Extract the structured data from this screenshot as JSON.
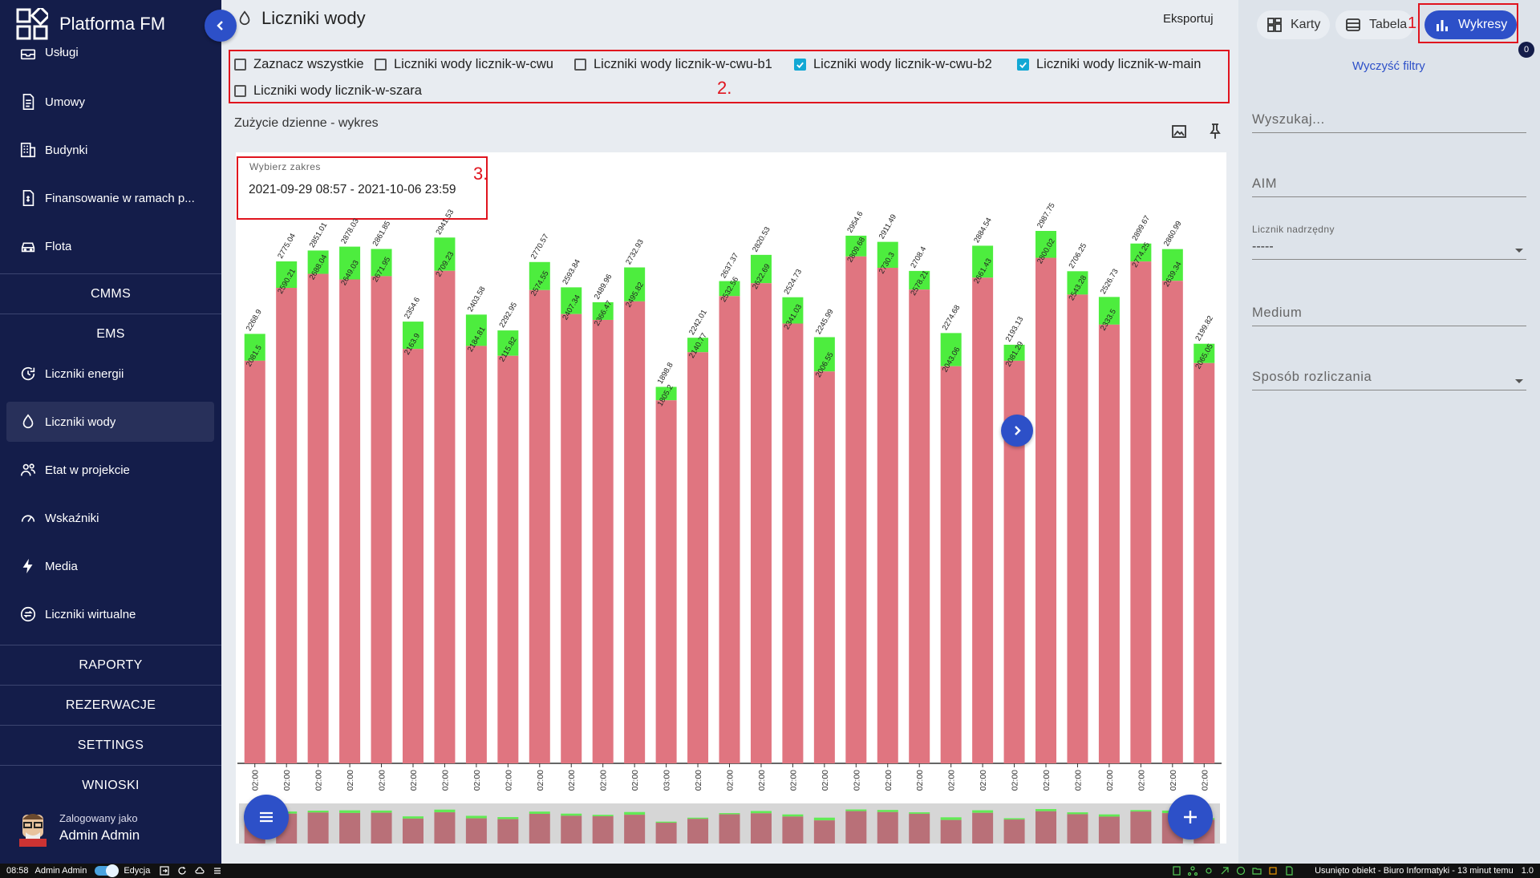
{
  "app": {
    "title": "Platforma FM"
  },
  "sidebar": {
    "items": [
      {
        "label": "Usługi",
        "icon": "tray-icon"
      },
      {
        "label": "Umowy",
        "icon": "document-icon"
      },
      {
        "label": "Budynki",
        "icon": "building-icon"
      },
      {
        "label": "Finansowanie w ramach p...",
        "icon": "finance-document-icon"
      },
      {
        "label": "Flota",
        "icon": "car-icon"
      }
    ],
    "sections": {
      "cmms": "CMMS",
      "ems": "EMS",
      "raporty": "RAPORTY",
      "rezerwacje": "REZERWACJE",
      "settings": "SETTINGS",
      "wnioski": "WNIOSKI"
    },
    "ems_items": [
      {
        "label": "Liczniki energii",
        "icon": "energy-meter-icon"
      },
      {
        "label": "Liczniki wody",
        "icon": "water-drop-icon",
        "active": true
      },
      {
        "label": "Etat w projekcie",
        "icon": "people-icon"
      },
      {
        "label": "Wskaźniki",
        "icon": "gauge-icon"
      },
      {
        "label": "Media",
        "icon": "lightning-icon"
      },
      {
        "label": "Liczniki wirtualne",
        "icon": "virtual-meter-icon"
      }
    ],
    "user": {
      "logged_as": "Zalogowany jako",
      "name": "Admin Admin"
    }
  },
  "header": {
    "title": "Liczniki wody",
    "export": "Eksportuj"
  },
  "filters": {
    "select_all": "Zaznacz wszystkie",
    "items": [
      {
        "label": "Liczniki wody licznik-w-cwu",
        "checked": false
      },
      {
        "label": "Liczniki wody licznik-w-cwu-b1",
        "checked": false
      },
      {
        "label": "Liczniki wody licznik-w-cwu-b2",
        "checked": true
      },
      {
        "label": "Liczniki wody licznik-w-main",
        "checked": true
      },
      {
        "label": "Liczniki wody licznik-w-szara",
        "checked": false
      }
    ],
    "annotation": "2."
  },
  "chart_section": {
    "title": "Zużycie dzienne - wykres"
  },
  "range": {
    "label": "Wybierz zakres",
    "value": "2021-09-29 08:57 - 2021-10-06 23:59",
    "annotation": "3."
  },
  "chart_data": {
    "type": "bar",
    "stacked": true,
    "x_tick_labels": [
      "02:00",
      "02:00",
      "02:00",
      "02:00",
      "02:00",
      "02:00",
      "02:00",
      "02:00",
      "02:00",
      "02:00",
      "02:00",
      "02:00",
      "02:00",
      "03:00",
      "02:00",
      "02:00",
      "02:00",
      "02:00",
      "02:00",
      "02:00",
      "02:00",
      "02:00",
      "02:00",
      "02:00",
      "02:00",
      "02:00",
      "02:00",
      "02:00",
      "02:00",
      "02:00",
      "02:00"
    ],
    "series": [
      {
        "values": [
          2081.5,
          2590.21,
          2688.04,
          2649.03,
          2671.95,
          2163.9,
          2709.23,
          2184.81,
          2115.82,
          2574.55,
          2407.34,
          2366.47,
          2495.82,
          1805.2,
          2140.77,
          2532.56,
          2622.69,
          2341.03,
          2006.55,
          2809.68,
          2730.3,
          2578.21,
          2043.06,
          2661.43,
          2081.29,
          2800.02,
          2543.28,
          2333.5,
          2774.25,
          2639.34,
          2065.05
        ],
        "color": "#e07580"
      },
      {
        "values": [
          2268.9,
          2775.04,
          2851.01,
          2878.03,
          2861.85,
          2354.6,
          2941.53,
          2403.58,
          2292.95,
          2770.57,
          2593.84,
          2489.96,
          2732.93,
          1898.8,
          2242.01,
          2637.37,
          2820.53,
          2524.73,
          2245.99,
          2954.6,
          2911.49,
          2708.4,
          2274.68,
          2884.54,
          2193.13,
          2987.75,
          2706.25,
          2526.73,
          2899.67,
          2860.99,
          2199.82
        ],
        "color": "#4ded3e"
      }
    ],
    "ylim": [
      0,
      3200
    ],
    "grid": false,
    "legend": "none"
  },
  "views": {
    "karty": "Karty",
    "tabela": "Tabela",
    "wykresy": "Wykresy",
    "annotation": "1.",
    "badge": "0"
  },
  "right_panel": {
    "clear": "Wyczyść filtry",
    "search_placeholder": "Wyszukaj...",
    "aim_placeholder": "AIM",
    "parent_label": "Licznik nadrzędny",
    "parent_value": "-----",
    "medium_placeholder": "Medium",
    "billing_placeholder": "Sposób rozliczania"
  },
  "status": {
    "time": "08:58",
    "user": "Admin Admin",
    "mode": "Edycja",
    "message": "Usunięto obiekt - Biuro Informatyki - 13 minut temu",
    "version": "1.0"
  }
}
